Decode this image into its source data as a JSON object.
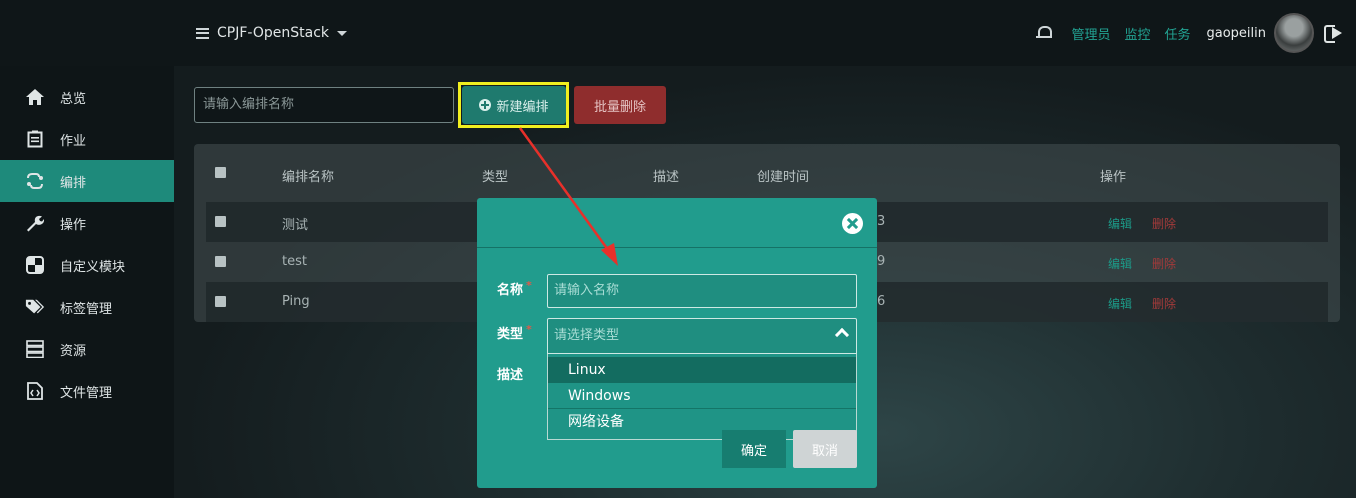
{
  "header": {
    "project": "CPJF-OpenStack",
    "links": [
      "管理员",
      "监控",
      "任务"
    ],
    "username": "gaopeilin"
  },
  "sidebar": {
    "items": [
      {
        "label": "总览",
        "icon": "home-icon"
      },
      {
        "label": "作业",
        "icon": "clipboard-icon"
      },
      {
        "label": "编排",
        "icon": "link-icon",
        "active": true
      },
      {
        "label": "操作",
        "icon": "wrench-icon"
      },
      {
        "label": "自定义模块",
        "icon": "puzzle-icon"
      },
      {
        "label": "标签管理",
        "icon": "tags-icon"
      },
      {
        "label": "资源",
        "icon": "server-icon"
      },
      {
        "label": "文件管理",
        "icon": "file-code-icon"
      }
    ]
  },
  "toolbar": {
    "search_placeholder": "请输入编排名称",
    "new_label": "新建编排",
    "batch_delete_label": "批量删除"
  },
  "table": {
    "columns": [
      "编排名称",
      "类型",
      "描述",
      "创建时间",
      "操作"
    ],
    "rows": [
      {
        "name": "测试",
        "time_tail": "3",
        "edit": "编辑",
        "delete": "删除"
      },
      {
        "name": "test",
        "time_tail": "9",
        "edit": "编辑",
        "delete": "删除"
      },
      {
        "name": "Ping",
        "time_tail": "6",
        "edit": "编辑",
        "delete": "删除"
      }
    ]
  },
  "modal": {
    "name_label": "名称",
    "name_placeholder": "请输入名称",
    "type_label": "类型",
    "type_placeholder": "请选择类型",
    "desc_label": "描述",
    "required_mark": "*",
    "type_options": [
      "Linux",
      "Windows",
      "网络设备"
    ],
    "ok_label": "确定",
    "cancel_label": "取消"
  },
  "colors": {
    "accent": "#219c8d",
    "danger": "#8f2d2d",
    "highlight": "#f1ef1f",
    "arrow": "#e8302a"
  }
}
